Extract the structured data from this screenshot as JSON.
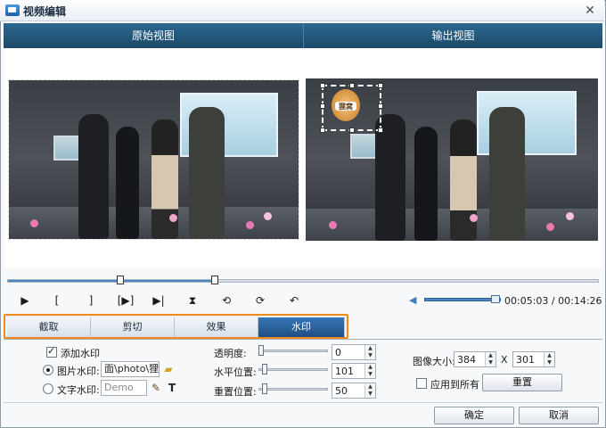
{
  "window": {
    "title": "视频编辑",
    "close_glyph": "✕"
  },
  "views": {
    "original_label": "原始视图",
    "output_label": "输出视图"
  },
  "watermark_overlay": {
    "logo_text": "狸窝"
  },
  "transport": {
    "play": "▶",
    "mark_in": "[",
    "mark_out": "]",
    "next_frame": "[▶]",
    "to_end": "▶|",
    "split": "⧗",
    "rotate_left": "⟲",
    "rotate_right": "⟳",
    "undo": "↶"
  },
  "playback": {
    "current": "00:05:03",
    "separator": "/",
    "total": "00:14:26",
    "progress_fraction": 0.35,
    "volume_fraction": 0.9
  },
  "tabs": [
    {
      "label": "截取",
      "active": false
    },
    {
      "label": "剪切",
      "active": false
    },
    {
      "label": "效果",
      "active": false
    },
    {
      "label": "水印",
      "active": true
    }
  ],
  "watermark": {
    "add_label": "添加水印",
    "image_label": "图片水印:",
    "image_path": "面\\photo\\狸窝",
    "text_label": "文字水印:",
    "text_placeholder": "Demo",
    "opacity_label": "透明度:",
    "opacity_value": "0",
    "h_position_label": "水平位置:",
    "h_position_value": "101",
    "v_position_label": "重置位置:",
    "v_position_value": "50",
    "image_size_label": "图像大小:",
    "width_value": "384",
    "size_separator": "X",
    "height_value": "301",
    "apply_all_label": "应用到所有",
    "reset_label": "重置"
  },
  "footer": {
    "ok_label": "确定",
    "cancel_label": "取消"
  },
  "colors": {
    "header": "#1c4a6a",
    "tab_active": "#1f4f82",
    "tab_panel_border": "#f08a1d",
    "progress": "#4b86c2"
  }
}
